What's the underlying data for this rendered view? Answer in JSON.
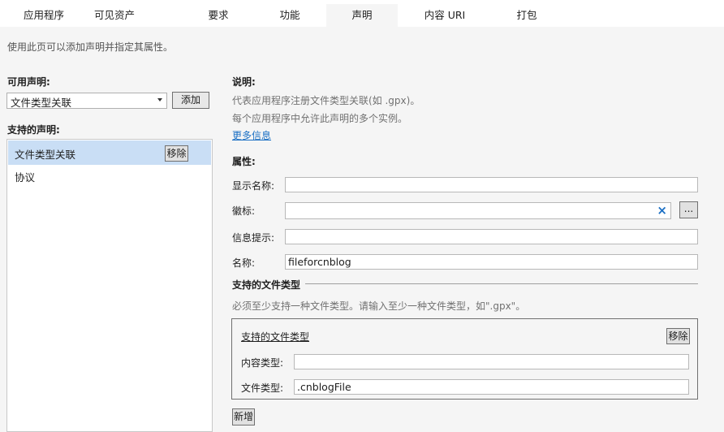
{
  "tabs": [
    {
      "label": "应用程序"
    },
    {
      "label": "可见资产"
    },
    {
      "label": "要求"
    },
    {
      "label": "功能"
    },
    {
      "label": "声明"
    },
    {
      "label": "内容 URI"
    },
    {
      "label": "打包"
    }
  ],
  "active_tab": "声明",
  "page_description": "使用此页可以添加声明并指定其属性。",
  "available": {
    "label": "可用声明:",
    "selected": "文件类型关联",
    "add_label": "添加"
  },
  "supported": {
    "label": "支持的声明:",
    "items": [
      {
        "label": "文件类型关联",
        "remove_label": "移除"
      },
      {
        "label": "协议"
      }
    ]
  },
  "description": {
    "title": "说明:",
    "line1": "代表应用程序注册文件类型关联(如 .gpx)。",
    "line2": "每个应用程序中允许此声明的多个实例。",
    "more_info": "更多信息"
  },
  "properties": {
    "title": "属性:",
    "display_name_label": "显示名称:",
    "display_name_value": "",
    "logo_label": "徽标:",
    "logo_value": "",
    "logo_clear": "×",
    "logo_browse": "...",
    "info_tip_label": "信息提示:",
    "info_tip_value": "",
    "name_label": "名称:",
    "name_value": "fileforcnblog"
  },
  "file_types": {
    "section_title": "支持的文件类型",
    "hint": "必须至少支持一种文件类型。请输入至少一种文件类型，如\".gpx\"。",
    "box_title": "支持的文件类型",
    "remove_label": "移除",
    "content_type_label": "内容类型:",
    "content_type_value": "",
    "file_type_label": "文件类型:",
    "file_type_value": ".cnblogFile",
    "add_new_label": "新增"
  },
  "colors": {
    "selected_row": "#c9def5",
    "link": "#1a6fc4",
    "clear_x": "#1a6fc4"
  }
}
